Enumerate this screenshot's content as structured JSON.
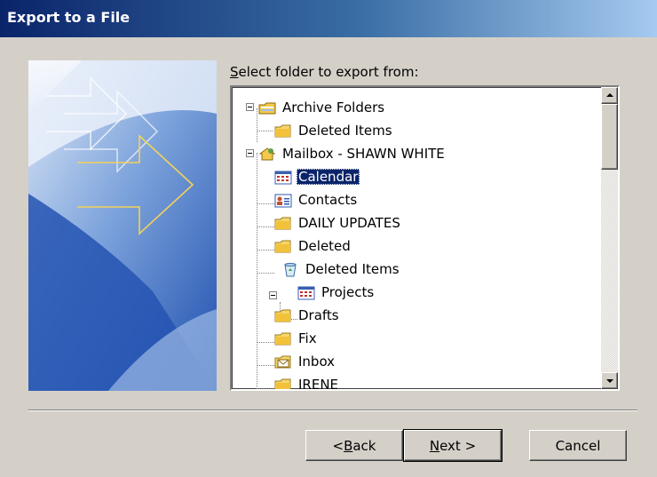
{
  "window": {
    "title": "Export to a File"
  },
  "prompt": {
    "pre": "",
    "mnemonic": "S",
    "post": "elect folder to export from:"
  },
  "tree": [
    {
      "label": "Archive Folders",
      "icon": "archive-folders-icon",
      "level": 0
    },
    {
      "label": "Deleted Items",
      "icon": "folder-icon",
      "level": 1
    },
    {
      "label": "Mailbox - SHAWN WHITE",
      "icon": "mailbox-icon",
      "level": 0
    },
    {
      "label": "Calendar",
      "icon": "calendar-icon",
      "level": 1,
      "selected": true
    },
    {
      "label": "Contacts",
      "icon": "contacts-icon",
      "level": 1
    },
    {
      "label": "DAILY UPDATES",
      "icon": "folder-icon",
      "level": 1
    },
    {
      "label": "Deleted",
      "icon": "folder-icon",
      "level": 1
    },
    {
      "label": "Deleted Items",
      "icon": "recycle-bin-icon",
      "level": 1
    },
    {
      "label": "Projects",
      "icon": "calendar-icon",
      "level": 2
    },
    {
      "label": "Drafts",
      "icon": "folder-icon",
      "level": 1
    },
    {
      "label": "Fix",
      "icon": "folder-icon",
      "level": 1
    },
    {
      "label": "Inbox",
      "icon": "inbox-icon",
      "level": 1
    },
    {
      "label": "IRENE",
      "icon": "folder-icon",
      "level": 1
    }
  ],
  "buttons": {
    "back": {
      "pre": "< ",
      "mnemonic": "B",
      "post": "ack"
    },
    "next": {
      "pre": "",
      "mnemonic": "N",
      "post": "ext >"
    },
    "cancel": {
      "label": "Cancel"
    }
  },
  "colors": {
    "selection": "#0a246a",
    "dialog_bg": "#d4d0c8",
    "title_start": "#0a246a",
    "title_end": "#a6caf0"
  }
}
